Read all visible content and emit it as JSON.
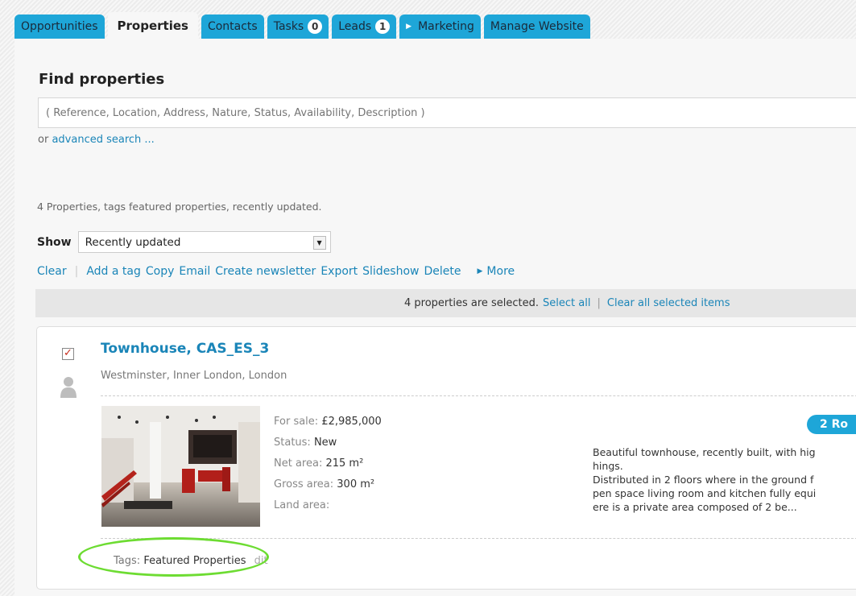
{
  "tabs": [
    {
      "label": "Opportunities",
      "count": null,
      "active": false
    },
    {
      "label": "Properties",
      "count": null,
      "active": true
    },
    {
      "label": "Contacts",
      "count": null,
      "active": false
    },
    {
      "label": "Tasks",
      "count": "0",
      "active": false
    },
    {
      "label": "Leads",
      "count": "1",
      "active": false
    },
    {
      "label": "Marketing",
      "count": null,
      "active": false
    },
    {
      "label": "Manage Website",
      "count": null,
      "active": false
    }
  ],
  "search": {
    "title": "Find properties",
    "placeholder": "( Reference, Location, Address, Nature, Status, Availability, Description )",
    "or_text": "or",
    "advanced_link": "advanced search ..."
  },
  "summary": "4 Properties, tags featured properties, recently updated.",
  "show": {
    "label": "Show",
    "selected": "Recently updated"
  },
  "actions": {
    "clear": "Clear",
    "items": [
      "Add a tag",
      "Copy",
      "Email",
      "Create newsletter",
      "Export",
      "Slideshow",
      "Delete"
    ],
    "more": "More"
  },
  "selection": {
    "message": "4 properties are selected.",
    "select_all": "Select all",
    "clear_all": "Clear all selected items"
  },
  "property": {
    "title": "Townhouse, CAS_ES_3",
    "location": "Westminster, Inner London, London",
    "checked": true,
    "sale_label": "For sale:",
    "price": "£2,985,000",
    "status_label": "Status:",
    "status": "New",
    "net_area_label": "Net area:",
    "net_area": "215 m²",
    "gross_area_label": "Gross area:",
    "gross_area": "300 m²",
    "land_area_label": "Land area:",
    "rooms_badge": "2 Ro",
    "description_lines": [
      "Beautiful townhouse, recently built, with hig",
      "hings.",
      "Distributed in 2 floors where in the ground f",
      "pen space living room and kitchen fully equi",
      "ere is a private area composed of 2 be..."
    ],
    "tags_label": "Tags:",
    "tags_value": "Featured Properties",
    "edit_link": "dit"
  },
  "colors": {
    "tab_blue": "#1ea6d8",
    "link_blue": "#1a85b8",
    "highlight_green": "#6ddc32",
    "check_red": "#c62a1a"
  }
}
